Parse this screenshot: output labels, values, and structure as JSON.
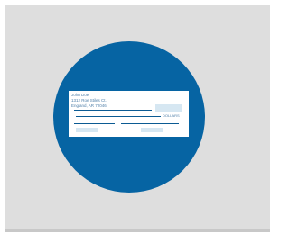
{
  "check": {
    "payer_name": "John Doe",
    "payer_street": "1312 Roe Stiles Ct.",
    "payer_city": "England, AR 72046",
    "dollars_label": "DOLLARS"
  },
  "colors": {
    "background_panel": "#dedede",
    "circle": "#0664a3",
    "check_paper": "#ffffff",
    "lines": "#0b5b93",
    "field_fill": "#d6e7f2",
    "text": "#4f7fa8"
  }
}
